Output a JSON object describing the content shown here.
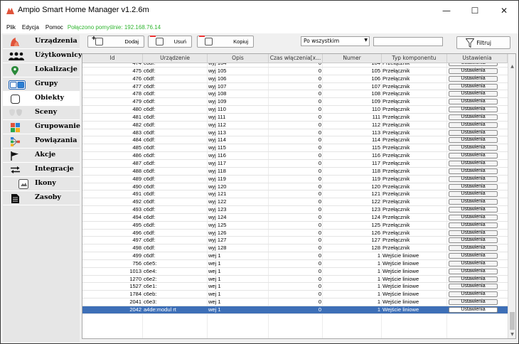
{
  "window": {
    "title": "Ampio Smart Home Manager v1.2.6m",
    "minimize_glyph": "—",
    "maximize_glyph": "☐",
    "close_glyph": "✕"
  },
  "menu": {
    "items": [
      "Plik",
      "Edycja",
      "Pomoc"
    ],
    "status": "Połączono pomyślnie: 192.168.76.14",
    "status_color": "#2fb52f"
  },
  "sidebar": {
    "items": [
      {
        "label": "Urządzenia",
        "icon": "device-icon"
      },
      {
        "label": "Użytkownicy",
        "icon": "users-icon"
      },
      {
        "label": "Lokalizacje",
        "icon": "location-pin-icon"
      },
      {
        "label": "Grupy",
        "icon": "groups-icon"
      },
      {
        "label": "Obiekty",
        "icon": "object-icon"
      },
      {
        "label": "Sceny",
        "icon": "scene-icon"
      },
      {
        "label": "Grupowanie",
        "icon": "grouping-icon"
      },
      {
        "label": "Powiązania",
        "icon": "links-icon"
      },
      {
        "label": "Akcje",
        "icon": "flag-icon"
      },
      {
        "label": "Integracje",
        "icon": "integration-arrows-icon"
      },
      {
        "label": "Ikony",
        "icon": "icons-icon"
      },
      {
        "label": "Zasoby",
        "icon": "resource-document-icon"
      }
    ],
    "active_index": 4,
    "accent_color": "#e0533a"
  },
  "toolbar": {
    "add_label": "Dodaj",
    "add_plus": "+",
    "delete_label": "Usuń",
    "copy_label": "Kopiuj",
    "filter_select_value": "Po wszystkim",
    "filter_input_value": "",
    "filter_button_label": "Filtruj"
  },
  "table": {
    "columns": [
      "Id",
      "Urządzenie",
      "Opis",
      "Czas włączenia[x...",
      "Numer",
      "Typ komponentu",
      "Ustawienia"
    ],
    "settings_label": "Ustawienia",
    "selected_color": "#3d6fb7",
    "rows": [
      {
        "id": "474",
        "device": "c6df:",
        "desc": "wyj 104",
        "time": "0",
        "num": "104",
        "type": "Przełącznik"
      },
      {
        "id": "475",
        "device": "c6df:",
        "desc": "wyj 105",
        "time": "0",
        "num": "105",
        "type": "Przełącznik"
      },
      {
        "id": "476",
        "device": "c6df:",
        "desc": "wyj 106",
        "time": "0",
        "num": "106",
        "type": "Przełącznik"
      },
      {
        "id": "477",
        "device": "c6df:",
        "desc": "wyj 107",
        "time": "0",
        "num": "107",
        "type": "Przełącznik"
      },
      {
        "id": "478",
        "device": "c6df:",
        "desc": "wyj 108",
        "time": "0",
        "num": "108",
        "type": "Przełącznik"
      },
      {
        "id": "479",
        "device": "c6df:",
        "desc": "wyj 109",
        "time": "0",
        "num": "109",
        "type": "Przełącznik"
      },
      {
        "id": "480",
        "device": "c6df:",
        "desc": "wyj 110",
        "time": "0",
        "num": "110",
        "type": "Przełącznik"
      },
      {
        "id": "481",
        "device": "c6df:",
        "desc": "wyj 111",
        "time": "0",
        "num": "111",
        "type": "Przełącznik"
      },
      {
        "id": "482",
        "device": "c6df:",
        "desc": "wyj 112",
        "time": "0",
        "num": "112",
        "type": "Przełącznik"
      },
      {
        "id": "483",
        "device": "c6df:",
        "desc": "wyj 113",
        "time": "0",
        "num": "113",
        "type": "Przełącznik"
      },
      {
        "id": "484",
        "device": "c6df:",
        "desc": "wyj 114",
        "time": "0",
        "num": "114",
        "type": "Przełącznik"
      },
      {
        "id": "485",
        "device": "c6df:",
        "desc": "wyj 115",
        "time": "0",
        "num": "115",
        "type": "Przełącznik"
      },
      {
        "id": "486",
        "device": "c6df:",
        "desc": "wyj 116",
        "time": "0",
        "num": "116",
        "type": "Przełącznik"
      },
      {
        "id": "487",
        "device": "c6df:",
        "desc": "wyj 117",
        "time": "0",
        "num": "117",
        "type": "Przełącznik"
      },
      {
        "id": "488",
        "device": "c6df:",
        "desc": "wyj 118",
        "time": "0",
        "num": "118",
        "type": "Przełącznik"
      },
      {
        "id": "489",
        "device": "c6df:",
        "desc": "wyj 119",
        "time": "0",
        "num": "119",
        "type": "Przełącznik"
      },
      {
        "id": "490",
        "device": "c6df:",
        "desc": "wyj 120",
        "time": "0",
        "num": "120",
        "type": "Przełącznik"
      },
      {
        "id": "491",
        "device": "c6df:",
        "desc": "wyj 121",
        "time": "0",
        "num": "121",
        "type": "Przełącznik"
      },
      {
        "id": "492",
        "device": "c6df:",
        "desc": "wyj 122",
        "time": "0",
        "num": "122",
        "type": "Przełącznik"
      },
      {
        "id": "493",
        "device": "c6df:",
        "desc": "wyj 123",
        "time": "0",
        "num": "123",
        "type": "Przełącznik"
      },
      {
        "id": "494",
        "device": "c6df:",
        "desc": "wyj 124",
        "time": "0",
        "num": "124",
        "type": "Przełącznik"
      },
      {
        "id": "495",
        "device": "c6df:",
        "desc": "wyj 125",
        "time": "0",
        "num": "125",
        "type": "Przełącznik"
      },
      {
        "id": "496",
        "device": "c6df:",
        "desc": "wyj 126",
        "time": "0",
        "num": "126",
        "type": "Przełącznik"
      },
      {
        "id": "497",
        "device": "c6df:",
        "desc": "wyj 127",
        "time": "0",
        "num": "127",
        "type": "Przełącznik"
      },
      {
        "id": "498",
        "device": "c6df:",
        "desc": "wyj 128",
        "time": "0",
        "num": "128",
        "type": "Przełącznik"
      },
      {
        "id": "499",
        "device": "c6df:",
        "desc": "wej 1",
        "time": "0",
        "num": "1",
        "type": "Wejście liniowe"
      },
      {
        "id": "756",
        "device": "c6e5:",
        "desc": "wej 1",
        "time": "0",
        "num": "1",
        "type": "Wejście liniowe"
      },
      {
        "id": "1013",
        "device": "c6e4:",
        "desc": "wej 1",
        "time": "0",
        "num": "1",
        "type": "Wejście liniowe"
      },
      {
        "id": "1270",
        "device": "c6e2:",
        "desc": "wej 1",
        "time": "0",
        "num": "1",
        "type": "Wejście liniowe"
      },
      {
        "id": "1527",
        "device": "c6e1:",
        "desc": "wej 1",
        "time": "0",
        "num": "1",
        "type": "Wejście liniowe"
      },
      {
        "id": "1784",
        "device": "c6eb:",
        "desc": "wej 1",
        "time": "0",
        "num": "1",
        "type": "Wejście liniowe"
      },
      {
        "id": "2041",
        "device": "c6e3:",
        "desc": "wej 1",
        "time": "0",
        "num": "1",
        "type": "Wejście liniowe"
      },
      {
        "id": "2042",
        "device": "a4de:modul rt",
        "desc": "wej 1",
        "time": "0",
        "num": "1",
        "type": "Wejście liniowe",
        "selected": true
      }
    ]
  }
}
